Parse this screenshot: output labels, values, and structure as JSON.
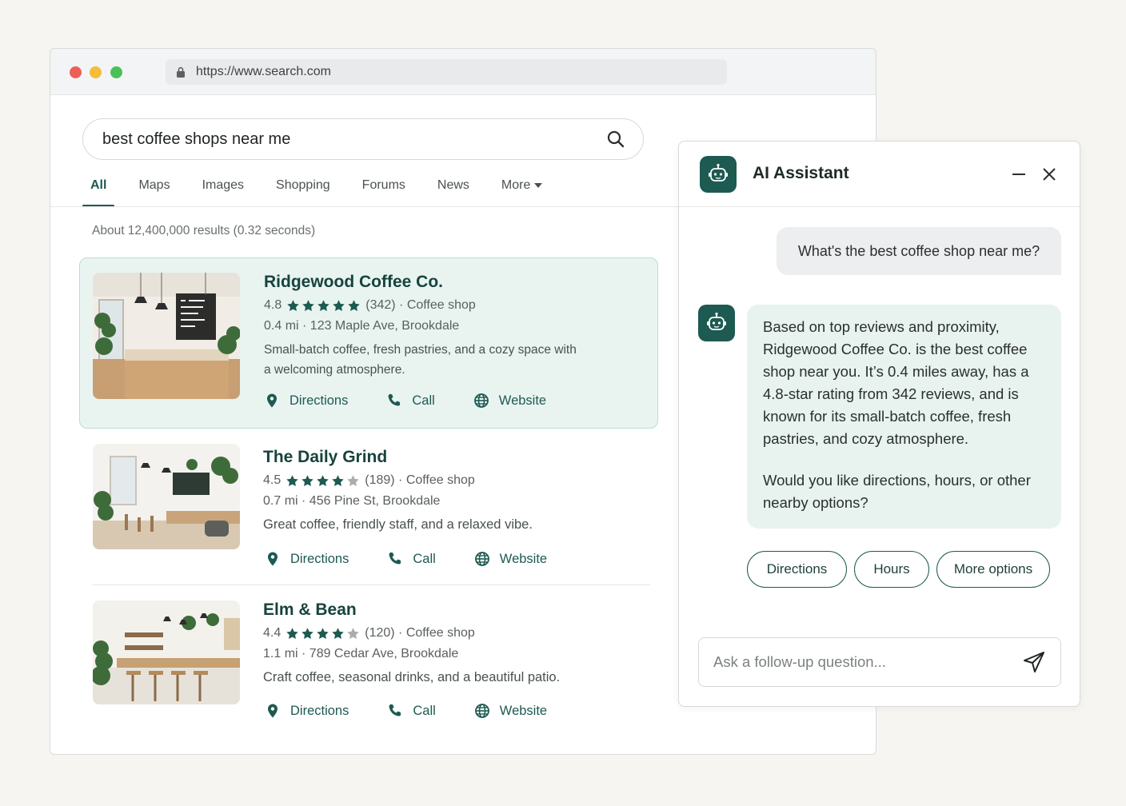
{
  "browser": {
    "url": "https://www.search.com"
  },
  "search": {
    "query": "best coffee shops near me",
    "tabs": [
      {
        "label": "All",
        "active": true
      },
      {
        "label": "Maps"
      },
      {
        "label": "Images"
      },
      {
        "label": "Shopping"
      },
      {
        "label": "Forums"
      },
      {
        "label": "News"
      },
      {
        "label": "More"
      }
    ],
    "result_count": "About 12,400,000 results (0.32 seconds)"
  },
  "results": [
    {
      "name": "Ridgewood Coffee Co.",
      "rating": "4.8",
      "stars": 5,
      "reviews": "(342) · Coffee shop",
      "address": "0.4 mi · 123 Maple Ave, Brookdale",
      "description": "Small-batch coffee, fresh pastries, and a cozy space with a welcoming atmosphere.",
      "actions": {
        "directions": "Directions",
        "call": "Call",
        "website": "Website"
      }
    },
    {
      "name": "The Daily Grind",
      "rating": "4.5",
      "stars": 4,
      "reviews": "(189) · Coffee shop",
      "address": "0.7 mi · 456 Pine St, Brookdale",
      "description": "Great coffee, friendly staff, and a relaxed vibe.",
      "actions": {
        "directions": "Directions",
        "call": "Call",
        "website": "Website"
      }
    },
    {
      "name": "Elm & Bean",
      "rating": "4.4",
      "stars": 4,
      "reviews": "(120) · Coffee shop",
      "address": "1.1 mi · 789 Cedar Ave, Brookdale",
      "description": "Craft coffee, seasonal drinks, and a beautiful patio.",
      "actions": {
        "directions": "Directions",
        "call": "Call",
        "website": "Website"
      }
    }
  ],
  "assistant": {
    "title": "AI Assistant",
    "user_message": "What's the best coffee shop near me?",
    "reply_paragraph_1": "Based on top reviews and proximity, Ridgewood Coffee Co. is the best coffee shop near you. It’s 0.4 miles away, has a 4.8-star rating from 342 reviews, and is known for its small-batch coffee, fresh pastries, and cozy atmosphere.",
    "reply_paragraph_2": "Would you like directions, hours, or other nearby options?",
    "chips": [
      "Directions",
      "Hours",
      "More options"
    ],
    "input_placeholder": "Ask a follow-up question..."
  },
  "colors": {
    "accent": "#1d5a51",
    "highlight_bg": "#e9f4f1",
    "star_filled": "#1d5a51",
    "star_empty": "#a9aeac"
  },
  "icons": {
    "lock": "lock-icon",
    "search": "search-icon",
    "directions": "map-pin-icon",
    "call": "phone-icon",
    "website": "globe-icon",
    "assistant": "robot-icon",
    "minimize": "minimize-icon",
    "close": "close-icon",
    "send": "send-icon"
  }
}
